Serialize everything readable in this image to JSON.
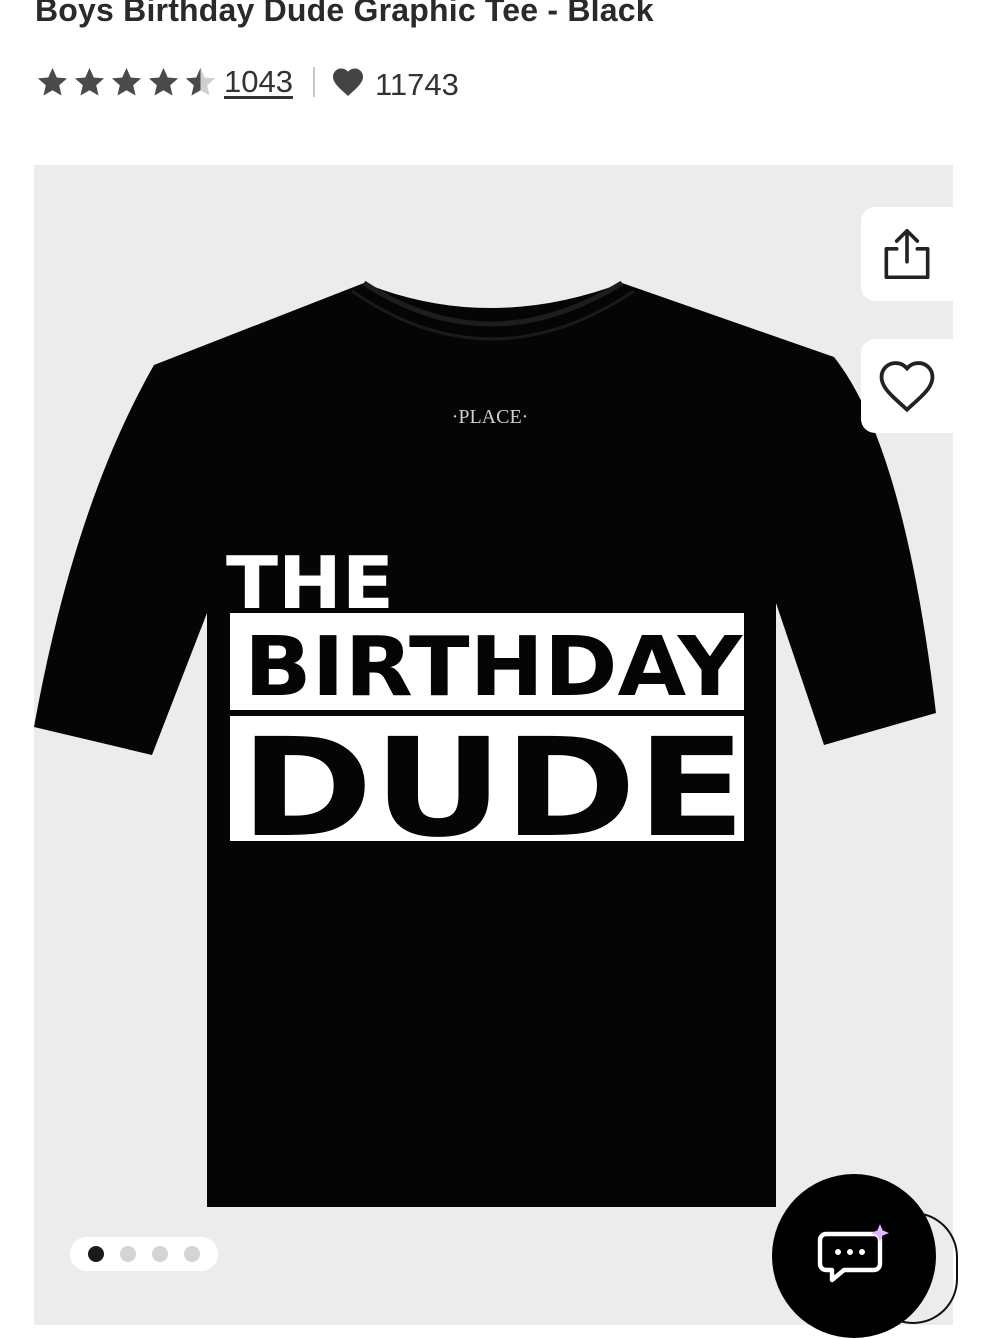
{
  "product": {
    "title": "Boys Birthday Dude Graphic Tee - Black",
    "rating": 4.5,
    "rating_max": 5,
    "review_count": "1043",
    "favorites_count": "11743"
  },
  "image": {
    "neckline_brand_text": "·PLACE·",
    "graphic_line1": "THE",
    "graphic_line2": "BIRTHDAY",
    "graphic_line3": "DUDE"
  },
  "carousel": {
    "count": 4,
    "active_index": 0
  },
  "colors": {
    "gallery_bg": "#ececec",
    "shirt": "#050505",
    "print": "#ffffff",
    "star": "#4a4a4a",
    "star_empty": "#cfcfcf"
  },
  "icons": {
    "share": "share-icon",
    "wishlist": "heart-outline-icon",
    "favorites": "heart-filled-icon",
    "chat": "chat-sparkle-icon"
  }
}
